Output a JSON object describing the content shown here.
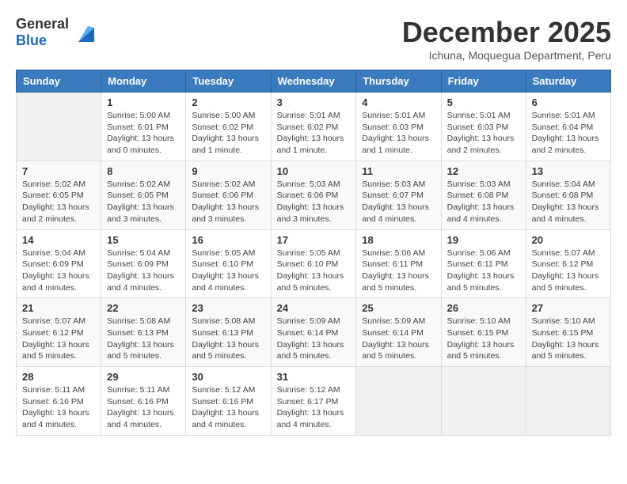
{
  "logo": {
    "general": "General",
    "blue": "Blue"
  },
  "title": "December 2025",
  "subtitle": "Ichuna, Moquegua Department, Peru",
  "days_header": [
    "Sunday",
    "Monday",
    "Tuesday",
    "Wednesday",
    "Thursday",
    "Friday",
    "Saturday"
  ],
  "weeks": [
    [
      {
        "day": "",
        "sunrise": "",
        "sunset": "",
        "daylight": ""
      },
      {
        "day": "1",
        "sunrise": "Sunrise: 5:00 AM",
        "sunset": "Sunset: 6:01 PM",
        "daylight": "Daylight: 13 hours and 0 minutes."
      },
      {
        "day": "2",
        "sunrise": "Sunrise: 5:00 AM",
        "sunset": "Sunset: 6:02 PM",
        "daylight": "Daylight: 13 hours and 1 minute."
      },
      {
        "day": "3",
        "sunrise": "Sunrise: 5:01 AM",
        "sunset": "Sunset: 6:02 PM",
        "daylight": "Daylight: 13 hours and 1 minute."
      },
      {
        "day": "4",
        "sunrise": "Sunrise: 5:01 AM",
        "sunset": "Sunset: 6:03 PM",
        "daylight": "Daylight: 13 hours and 1 minute."
      },
      {
        "day": "5",
        "sunrise": "Sunrise: 5:01 AM",
        "sunset": "Sunset: 6:03 PM",
        "daylight": "Daylight: 13 hours and 2 minutes."
      },
      {
        "day": "6",
        "sunrise": "Sunrise: 5:01 AM",
        "sunset": "Sunset: 6:04 PM",
        "daylight": "Daylight: 13 hours and 2 minutes."
      }
    ],
    [
      {
        "day": "7",
        "sunrise": "Sunrise: 5:02 AM",
        "sunset": "Sunset: 6:05 PM",
        "daylight": "Daylight: 13 hours and 2 minutes."
      },
      {
        "day": "8",
        "sunrise": "Sunrise: 5:02 AM",
        "sunset": "Sunset: 6:05 PM",
        "daylight": "Daylight: 13 hours and 3 minutes."
      },
      {
        "day": "9",
        "sunrise": "Sunrise: 5:02 AM",
        "sunset": "Sunset: 6:06 PM",
        "daylight": "Daylight: 13 hours and 3 minutes."
      },
      {
        "day": "10",
        "sunrise": "Sunrise: 5:03 AM",
        "sunset": "Sunset: 6:06 PM",
        "daylight": "Daylight: 13 hours and 3 minutes."
      },
      {
        "day": "11",
        "sunrise": "Sunrise: 5:03 AM",
        "sunset": "Sunset: 6:07 PM",
        "daylight": "Daylight: 13 hours and 4 minutes."
      },
      {
        "day": "12",
        "sunrise": "Sunrise: 5:03 AM",
        "sunset": "Sunset: 6:08 PM",
        "daylight": "Daylight: 13 hours and 4 minutes."
      },
      {
        "day": "13",
        "sunrise": "Sunrise: 5:04 AM",
        "sunset": "Sunset: 6:08 PM",
        "daylight": "Daylight: 13 hours and 4 minutes."
      }
    ],
    [
      {
        "day": "14",
        "sunrise": "Sunrise: 5:04 AM",
        "sunset": "Sunset: 6:09 PM",
        "daylight": "Daylight: 13 hours and 4 minutes."
      },
      {
        "day": "15",
        "sunrise": "Sunrise: 5:04 AM",
        "sunset": "Sunset: 6:09 PM",
        "daylight": "Daylight: 13 hours and 4 minutes."
      },
      {
        "day": "16",
        "sunrise": "Sunrise: 5:05 AM",
        "sunset": "Sunset: 6:10 PM",
        "daylight": "Daylight: 13 hours and 4 minutes."
      },
      {
        "day": "17",
        "sunrise": "Sunrise: 5:05 AM",
        "sunset": "Sunset: 6:10 PM",
        "daylight": "Daylight: 13 hours and 5 minutes."
      },
      {
        "day": "18",
        "sunrise": "Sunrise: 5:06 AM",
        "sunset": "Sunset: 6:11 PM",
        "daylight": "Daylight: 13 hours and 5 minutes."
      },
      {
        "day": "19",
        "sunrise": "Sunrise: 5:06 AM",
        "sunset": "Sunset: 6:11 PM",
        "daylight": "Daylight: 13 hours and 5 minutes."
      },
      {
        "day": "20",
        "sunrise": "Sunrise: 5:07 AM",
        "sunset": "Sunset: 6:12 PM",
        "daylight": "Daylight: 13 hours and 5 minutes."
      }
    ],
    [
      {
        "day": "21",
        "sunrise": "Sunrise: 5:07 AM",
        "sunset": "Sunset: 6:12 PM",
        "daylight": "Daylight: 13 hours and 5 minutes."
      },
      {
        "day": "22",
        "sunrise": "Sunrise: 5:08 AM",
        "sunset": "Sunset: 6:13 PM",
        "daylight": "Daylight: 13 hours and 5 minutes."
      },
      {
        "day": "23",
        "sunrise": "Sunrise: 5:08 AM",
        "sunset": "Sunset: 6:13 PM",
        "daylight": "Daylight: 13 hours and 5 minutes."
      },
      {
        "day": "24",
        "sunrise": "Sunrise: 5:09 AM",
        "sunset": "Sunset: 6:14 PM",
        "daylight": "Daylight: 13 hours and 5 minutes."
      },
      {
        "day": "25",
        "sunrise": "Sunrise: 5:09 AM",
        "sunset": "Sunset: 6:14 PM",
        "daylight": "Daylight: 13 hours and 5 minutes."
      },
      {
        "day": "26",
        "sunrise": "Sunrise: 5:10 AM",
        "sunset": "Sunset: 6:15 PM",
        "daylight": "Daylight: 13 hours and 5 minutes."
      },
      {
        "day": "27",
        "sunrise": "Sunrise: 5:10 AM",
        "sunset": "Sunset: 6:15 PM",
        "daylight": "Daylight: 13 hours and 5 minutes."
      }
    ],
    [
      {
        "day": "28",
        "sunrise": "Sunrise: 5:11 AM",
        "sunset": "Sunset: 6:16 PM",
        "daylight": "Daylight: 13 hours and 4 minutes."
      },
      {
        "day": "29",
        "sunrise": "Sunrise: 5:11 AM",
        "sunset": "Sunset: 6:16 PM",
        "daylight": "Daylight: 13 hours and 4 minutes."
      },
      {
        "day": "30",
        "sunrise": "Sunrise: 5:12 AM",
        "sunset": "Sunset: 6:16 PM",
        "daylight": "Daylight: 13 hours and 4 minutes."
      },
      {
        "day": "31",
        "sunrise": "Sunrise: 5:12 AM",
        "sunset": "Sunset: 6:17 PM",
        "daylight": "Daylight: 13 hours and 4 minutes."
      },
      {
        "day": "",
        "sunrise": "",
        "sunset": "",
        "daylight": ""
      },
      {
        "day": "",
        "sunrise": "",
        "sunset": "",
        "daylight": ""
      },
      {
        "day": "",
        "sunrise": "",
        "sunset": "",
        "daylight": ""
      }
    ]
  ]
}
